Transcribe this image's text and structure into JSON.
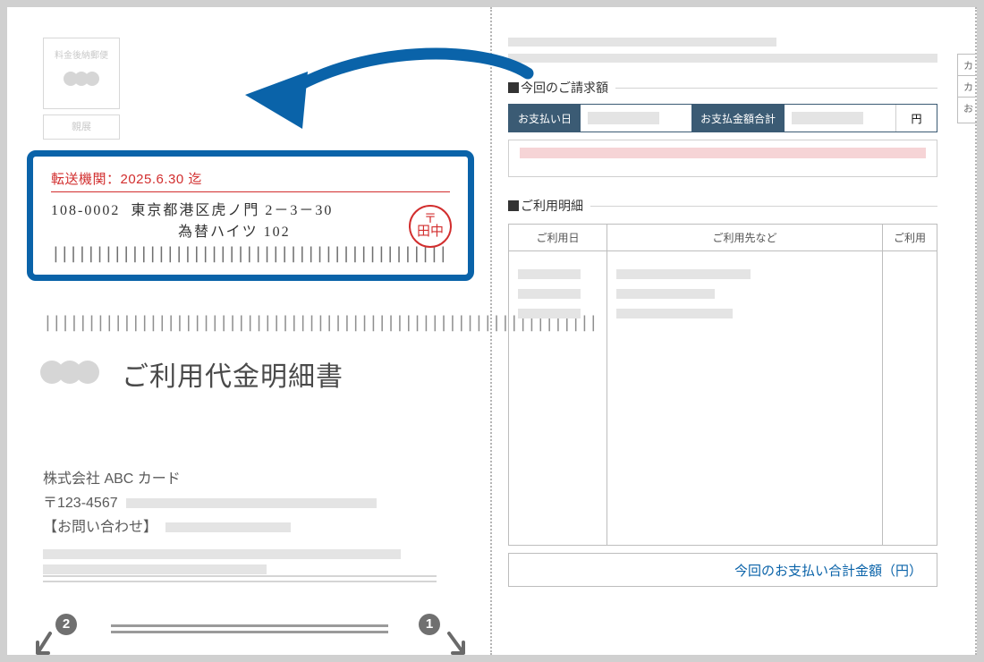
{
  "left": {
    "postage_label": "料金後納郵便",
    "confidential_label": "親展",
    "address": {
      "forward_notice": "転送機関：2025.6.30 迄",
      "postal_code": "108-0002",
      "line1": "東京都港区虎ノ門 2－3－30",
      "line2": "為替ハイツ 102",
      "stamp_top": "〒",
      "stamp_name": "田中"
    },
    "doc_title": "ご利用代金明細書",
    "company_name": "株式会社 ABC カード",
    "company_postal": "〒123-4567",
    "contact_label": "【お問い合わせ】",
    "foot_num_left": "2",
    "foot_num_right": "1"
  },
  "right": {
    "bill_section": "今回のご請求額",
    "pay_date_label": "お支払い日",
    "pay_total_label": "お支払金額合計",
    "yen_label": "円",
    "detail_section": "ご利用明細",
    "col_date": "ご利用日",
    "col_merchant": "ご利用先など",
    "col_amount": "ご利用",
    "side_k1": "カ",
    "side_k2": "カ",
    "side_o": "お",
    "total_label": "今回のお支払い合計金額（円）"
  }
}
